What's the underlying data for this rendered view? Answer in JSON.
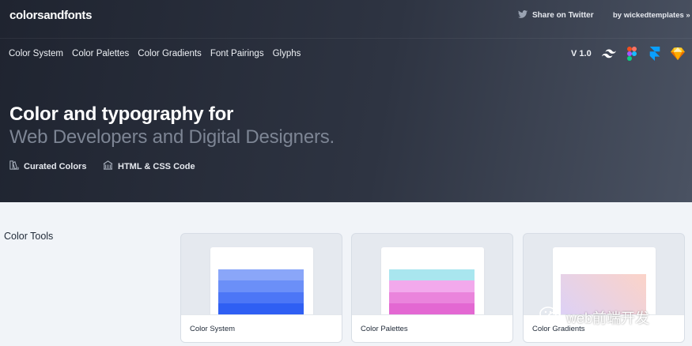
{
  "header": {
    "logo": "colorsandfonts",
    "share_label": "Share on Twitter",
    "byline": "by wickedtemplates »"
  },
  "nav": {
    "items": [
      "Color System",
      "Color Palettes",
      "Color Gradients",
      "Font Pairings",
      "Glyphs"
    ]
  },
  "tools": {
    "version": "V 1.0",
    "icons": [
      "tailwind-icon",
      "figma-icon",
      "framer-icon",
      "sketch-icon"
    ]
  },
  "hero": {
    "headline_line1": "Color and typography for",
    "headline_line2": "Web Developers and Digital Designers.",
    "features": [
      "Curated Colors",
      "HTML & CSS Code"
    ]
  },
  "section": {
    "title": "Color Tools"
  },
  "cards": [
    {
      "label": "Color System",
      "stripes": [
        "#8aa6f9",
        "#6b8ff8",
        "#4c76f6",
        "#2f5ff3"
      ]
    },
    {
      "label": "Color Palettes",
      "stripes": [
        "#a9e6ef",
        "#f2a9ec",
        "#ea84dc",
        "#e368d2"
      ]
    },
    {
      "label": "Color Gradients",
      "gradient": [
        "#dcd1f7",
        "#fbd3c8"
      ]
    }
  ],
  "watermark": {
    "text": "web前端开发"
  },
  "colors": {
    "hero_start": "#1f2430",
    "hero_end": "#4a5262",
    "page_bg": "#f1f4f8"
  }
}
